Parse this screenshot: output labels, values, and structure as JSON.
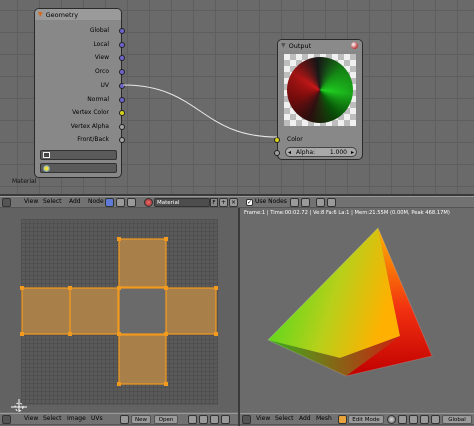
{
  "geometry_node": {
    "title": "Geometry",
    "outputs": [
      "Global",
      "Local",
      "View",
      "Orco",
      "UV",
      "Normal",
      "Vertex Color",
      "Vertex Alpha",
      "Front/Back"
    ]
  },
  "output_node": {
    "title": "Output",
    "input_label": "Color",
    "alpha_label": "Alpha:",
    "alpha_value": "1.000"
  },
  "node_editor": {
    "material_label": "Material",
    "menu": [
      "View",
      "Select",
      "Add",
      "Node"
    ],
    "material_field": "Material",
    "users_label": "F",
    "use_nodes_label": "Use Nodes"
  },
  "viewport_3d": {
    "info": "Frame:1 | Time:00:02.72 | Ve:8 Fa:6 La:1 | Mem:21.55M (0.00M, Peak 468.17M)",
    "menu": [
      "View",
      "Select",
      "Add",
      "Mesh"
    ],
    "mode": "Edit Mode",
    "orientation": "Global"
  },
  "uv_editor": {
    "menu": [
      "View",
      "Select",
      "Image",
      "UVs"
    ],
    "new_label": "New",
    "open_label": "Open"
  },
  "colors": {
    "uv_face": "#b98748",
    "uv_edge": "#f29a1e",
    "node_bg": "#888888",
    "geometry_header": "#9a9a9a"
  }
}
